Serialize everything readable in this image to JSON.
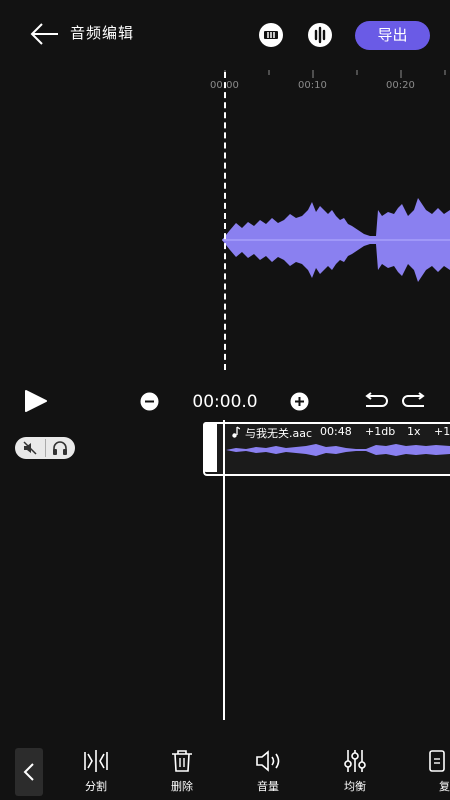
{
  "header": {
    "title": "音频编辑",
    "export_label": "导出"
  },
  "ruler": {
    "ticks": [
      "00:00",
      "00:10",
      "00:20"
    ]
  },
  "controls": {
    "time": "00:00.0"
  },
  "clip": {
    "filename": "与我无关.aac",
    "duration": "00:48",
    "gain": "+1db",
    "speed": "1x",
    "extra": "+1"
  },
  "toolbar": {
    "items": [
      {
        "label": "分割",
        "icon": "split-icon"
      },
      {
        "label": "删除",
        "icon": "delete-icon"
      },
      {
        "label": "音量",
        "icon": "volume-icon"
      },
      {
        "label": "均衡",
        "icon": "equalizer-icon"
      },
      {
        "label": "复",
        "icon": "copy-icon"
      }
    ]
  },
  "colors": {
    "accent": "#6a5be6",
    "waveform": "#8a80f0",
    "background": "#121212"
  }
}
